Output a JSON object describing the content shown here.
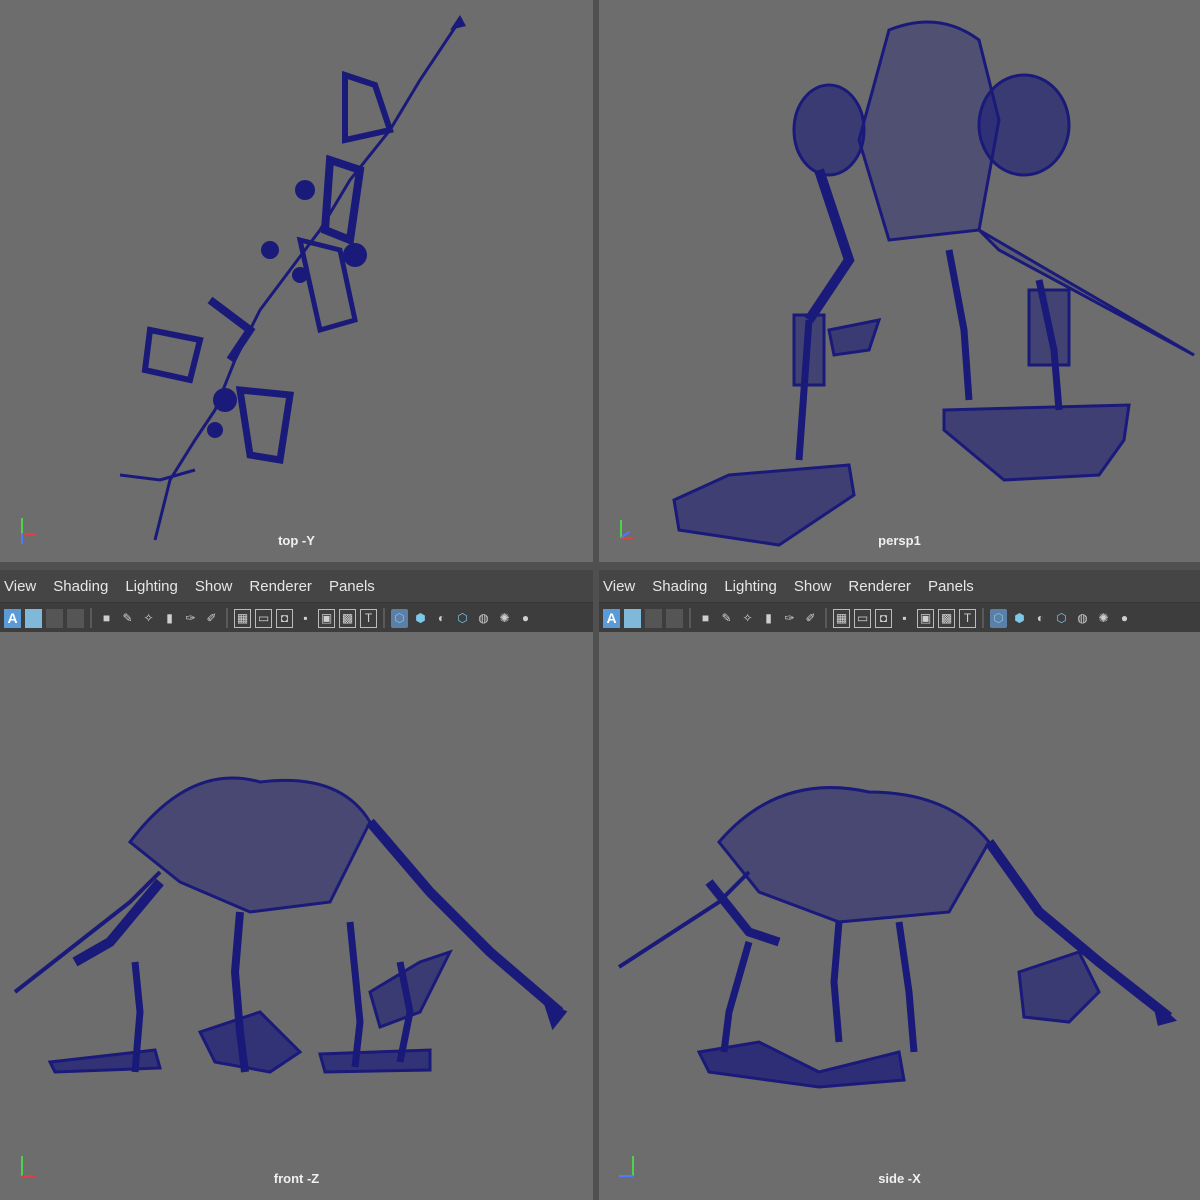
{
  "viewports": {
    "top": {
      "label": "top -Y"
    },
    "persp": {
      "label": "persp1"
    },
    "front": {
      "label": "front -Z"
    },
    "side": {
      "label": "side -X"
    }
  },
  "axes": {
    "x": "x",
    "y": "y",
    "z": "z"
  },
  "menus": [
    "View",
    "Shading",
    "Lighting",
    "Show",
    "Renderer",
    "Panels"
  ],
  "toolbar_icons": [
    "select-camera-icon",
    "camera-attributes-icon",
    "bookmark-icon",
    "image-plane-icon",
    "pencil-icon",
    "grid-icon",
    "film-gate-icon",
    "resolution-gate-icon",
    "safe-area-icon",
    "wireframe-icon",
    "smooth-shade-icon",
    "use-default-material-icon",
    "xray-icon",
    "lights-icon",
    "shadows-icon"
  ],
  "colors": {
    "viewport_bg": "#6d6d6d",
    "wireframe": "#1a1a7a",
    "accent": "#5a9ad6"
  }
}
